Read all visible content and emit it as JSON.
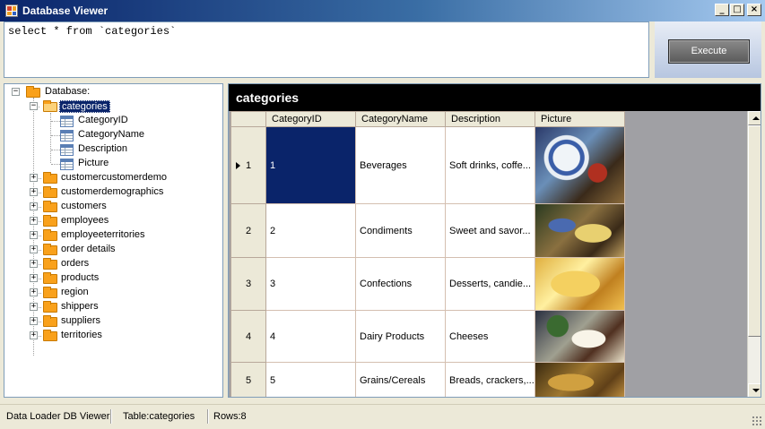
{
  "window": {
    "title": "Database Viewer"
  },
  "query": {
    "text": "select * from `categories`"
  },
  "execute_label": "Execute",
  "tree": {
    "root": "Database:",
    "selected_table": "categories",
    "columns": [
      "CategoryID",
      "CategoryName",
      "Description",
      "Picture"
    ],
    "tables": [
      "customercustomerdemo",
      "customerdemographics",
      "customers",
      "employees",
      "employeeterritories",
      "order details",
      "orders",
      "products",
      "region",
      "shippers",
      "suppliers",
      "territories"
    ]
  },
  "grid": {
    "caption": "categories",
    "headers": [
      "CategoryID",
      "CategoryName",
      "Description",
      "Picture"
    ],
    "rows": [
      {
        "num": "1",
        "id": "1",
        "name": "Beverages",
        "desc": "Soft drinks, coffe..."
      },
      {
        "num": "2",
        "id": "2",
        "name": "Condiments",
        "desc": "Sweet and savor..."
      },
      {
        "num": "3",
        "id": "3",
        "name": "Confections",
        "desc": "Desserts, candie..."
      },
      {
        "num": "4",
        "id": "4",
        "name": "Dairy Products",
        "desc": "Cheeses"
      },
      {
        "num": "5",
        "id": "5",
        "name": "Grains/Cereals",
        "desc": "Breads, crackers,..."
      }
    ]
  },
  "status": {
    "app": "Data Loader DB Viewer",
    "table": "Table:categories",
    "rows": "Rows:8"
  },
  "colors": {
    "selection": "#0a246a",
    "folder": "#f9a11b",
    "caption_bg": "#000000",
    "grid_bg": "#a0a0a4"
  }
}
